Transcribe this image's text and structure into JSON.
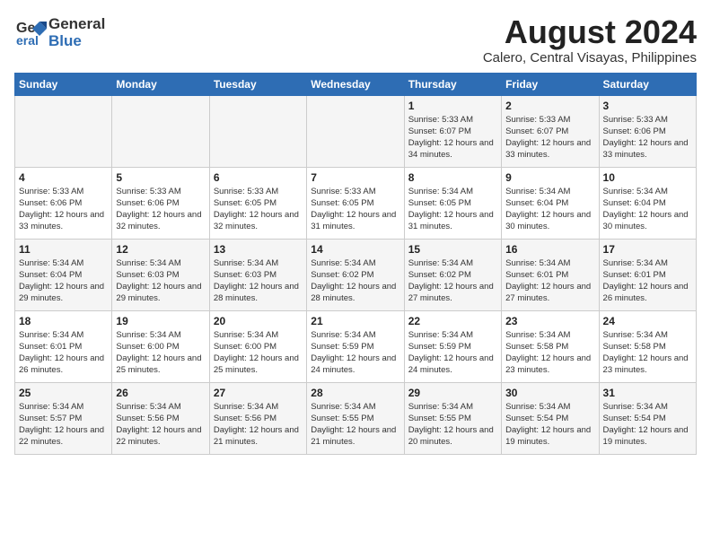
{
  "header": {
    "logo_general": "General",
    "logo_blue": "Blue",
    "title": "August 2024",
    "location": "Calero, Central Visayas, Philippines"
  },
  "weekdays": [
    "Sunday",
    "Monday",
    "Tuesday",
    "Wednesday",
    "Thursday",
    "Friday",
    "Saturday"
  ],
  "weeks": [
    [
      {
        "day": "",
        "sunrise": "",
        "sunset": "",
        "daylight": ""
      },
      {
        "day": "",
        "sunrise": "",
        "sunset": "",
        "daylight": ""
      },
      {
        "day": "",
        "sunrise": "",
        "sunset": "",
        "daylight": ""
      },
      {
        "day": "",
        "sunrise": "",
        "sunset": "",
        "daylight": ""
      },
      {
        "day": "1",
        "sunrise": "Sunrise: 5:33 AM",
        "sunset": "Sunset: 6:07 PM",
        "daylight": "Daylight: 12 hours and 34 minutes."
      },
      {
        "day": "2",
        "sunrise": "Sunrise: 5:33 AM",
        "sunset": "Sunset: 6:07 PM",
        "daylight": "Daylight: 12 hours and 33 minutes."
      },
      {
        "day": "3",
        "sunrise": "Sunrise: 5:33 AM",
        "sunset": "Sunset: 6:06 PM",
        "daylight": "Daylight: 12 hours and 33 minutes."
      }
    ],
    [
      {
        "day": "4",
        "sunrise": "Sunrise: 5:33 AM",
        "sunset": "Sunset: 6:06 PM",
        "daylight": "Daylight: 12 hours and 33 minutes."
      },
      {
        "day": "5",
        "sunrise": "Sunrise: 5:33 AM",
        "sunset": "Sunset: 6:06 PM",
        "daylight": "Daylight: 12 hours and 32 minutes."
      },
      {
        "day": "6",
        "sunrise": "Sunrise: 5:33 AM",
        "sunset": "Sunset: 6:05 PM",
        "daylight": "Daylight: 12 hours and 32 minutes."
      },
      {
        "day": "7",
        "sunrise": "Sunrise: 5:33 AM",
        "sunset": "Sunset: 6:05 PM",
        "daylight": "Daylight: 12 hours and 31 minutes."
      },
      {
        "day": "8",
        "sunrise": "Sunrise: 5:34 AM",
        "sunset": "Sunset: 6:05 PM",
        "daylight": "Daylight: 12 hours and 31 minutes."
      },
      {
        "day": "9",
        "sunrise": "Sunrise: 5:34 AM",
        "sunset": "Sunset: 6:04 PM",
        "daylight": "Daylight: 12 hours and 30 minutes."
      },
      {
        "day": "10",
        "sunrise": "Sunrise: 5:34 AM",
        "sunset": "Sunset: 6:04 PM",
        "daylight": "Daylight: 12 hours and 30 minutes."
      }
    ],
    [
      {
        "day": "11",
        "sunrise": "Sunrise: 5:34 AM",
        "sunset": "Sunset: 6:04 PM",
        "daylight": "Daylight: 12 hours and 29 minutes."
      },
      {
        "day": "12",
        "sunrise": "Sunrise: 5:34 AM",
        "sunset": "Sunset: 6:03 PM",
        "daylight": "Daylight: 12 hours and 29 minutes."
      },
      {
        "day": "13",
        "sunrise": "Sunrise: 5:34 AM",
        "sunset": "Sunset: 6:03 PM",
        "daylight": "Daylight: 12 hours and 28 minutes."
      },
      {
        "day": "14",
        "sunrise": "Sunrise: 5:34 AM",
        "sunset": "Sunset: 6:02 PM",
        "daylight": "Daylight: 12 hours and 28 minutes."
      },
      {
        "day": "15",
        "sunrise": "Sunrise: 5:34 AM",
        "sunset": "Sunset: 6:02 PM",
        "daylight": "Daylight: 12 hours and 27 minutes."
      },
      {
        "day": "16",
        "sunrise": "Sunrise: 5:34 AM",
        "sunset": "Sunset: 6:01 PM",
        "daylight": "Daylight: 12 hours and 27 minutes."
      },
      {
        "day": "17",
        "sunrise": "Sunrise: 5:34 AM",
        "sunset": "Sunset: 6:01 PM",
        "daylight": "Daylight: 12 hours and 26 minutes."
      }
    ],
    [
      {
        "day": "18",
        "sunrise": "Sunrise: 5:34 AM",
        "sunset": "Sunset: 6:01 PM",
        "daylight": "Daylight: 12 hours and 26 minutes."
      },
      {
        "day": "19",
        "sunrise": "Sunrise: 5:34 AM",
        "sunset": "Sunset: 6:00 PM",
        "daylight": "Daylight: 12 hours and 25 minutes."
      },
      {
        "day": "20",
        "sunrise": "Sunrise: 5:34 AM",
        "sunset": "Sunset: 6:00 PM",
        "daylight": "Daylight: 12 hours and 25 minutes."
      },
      {
        "day": "21",
        "sunrise": "Sunrise: 5:34 AM",
        "sunset": "Sunset: 5:59 PM",
        "daylight": "Daylight: 12 hours and 24 minutes."
      },
      {
        "day": "22",
        "sunrise": "Sunrise: 5:34 AM",
        "sunset": "Sunset: 5:59 PM",
        "daylight": "Daylight: 12 hours and 24 minutes."
      },
      {
        "day": "23",
        "sunrise": "Sunrise: 5:34 AM",
        "sunset": "Sunset: 5:58 PM",
        "daylight": "Daylight: 12 hours and 23 minutes."
      },
      {
        "day": "24",
        "sunrise": "Sunrise: 5:34 AM",
        "sunset": "Sunset: 5:58 PM",
        "daylight": "Daylight: 12 hours and 23 minutes."
      }
    ],
    [
      {
        "day": "25",
        "sunrise": "Sunrise: 5:34 AM",
        "sunset": "Sunset: 5:57 PM",
        "daylight": "Daylight: 12 hours and 22 minutes."
      },
      {
        "day": "26",
        "sunrise": "Sunrise: 5:34 AM",
        "sunset": "Sunset: 5:56 PM",
        "daylight": "Daylight: 12 hours and 22 minutes."
      },
      {
        "day": "27",
        "sunrise": "Sunrise: 5:34 AM",
        "sunset": "Sunset: 5:56 PM",
        "daylight": "Daylight: 12 hours and 21 minutes."
      },
      {
        "day": "28",
        "sunrise": "Sunrise: 5:34 AM",
        "sunset": "Sunset: 5:55 PM",
        "daylight": "Daylight: 12 hours and 21 minutes."
      },
      {
        "day": "29",
        "sunrise": "Sunrise: 5:34 AM",
        "sunset": "Sunset: 5:55 PM",
        "daylight": "Daylight: 12 hours and 20 minutes."
      },
      {
        "day": "30",
        "sunrise": "Sunrise: 5:34 AM",
        "sunset": "Sunset: 5:54 PM",
        "daylight": "Daylight: 12 hours and 19 minutes."
      },
      {
        "day": "31",
        "sunrise": "Sunrise: 5:34 AM",
        "sunset": "Sunset: 5:54 PM",
        "daylight": "Daylight: 12 hours and 19 minutes."
      }
    ]
  ]
}
